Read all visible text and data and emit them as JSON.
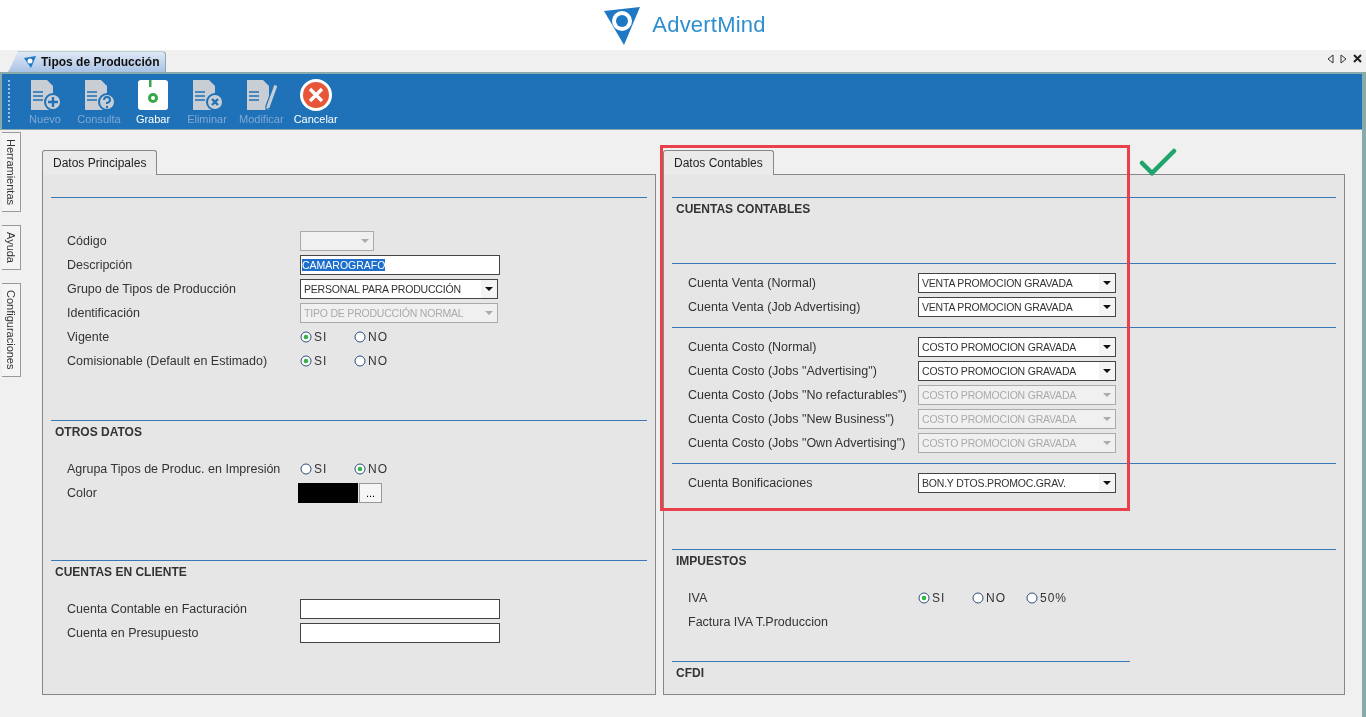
{
  "brand": {
    "name": "AdvertMind"
  },
  "document_tab": {
    "title": "Tipos de Producción",
    "selected": true
  },
  "toolbar": [
    {
      "label": "Nuevo",
      "kind": "new",
      "disabled": true
    },
    {
      "label": "Consulta",
      "kind": "query",
      "disabled": true
    },
    {
      "label": "Grabar",
      "kind": "save",
      "disabled": false
    },
    {
      "label": "Eliminar",
      "kind": "delete",
      "disabled": true
    },
    {
      "label": "Modificar",
      "kind": "edit",
      "disabled": true
    },
    {
      "label": "Cancelar",
      "kind": "cancel",
      "disabled": false
    }
  ],
  "side_tabs": [
    {
      "label": "Herramientas"
    },
    {
      "label": "Ayuda"
    },
    {
      "label": "Configuraciones"
    }
  ],
  "panels": [
    {
      "tab": "Datos Principales",
      "sections": [
        {
          "rows": [
            {
              "label": "Código",
              "kind": "select",
              "disabled": true
            },
            {
              "label": "Descripción",
              "kind": "text",
              "value": "CAMAROGRAFO",
              "selected": true
            },
            {
              "label": "Grupo de Tipos de Producción",
              "kind": "select",
              "value": "PERSONAL PARA PRODUCCIÓN",
              "disabled": false
            },
            {
              "label": "Identificación",
              "kind": "select",
              "value": "TIPO DE PRODUCCIÓN NORMAL",
              "disabled": true
            },
            {
              "label": "Vigente",
              "kind": "radio",
              "options": [
                {
                  "label": "SI",
                  "selected": true
                },
                {
                  "label": "NO",
                  "selected": false
                }
              ]
            },
            {
              "label": "Comisionable (Default en Estimado)",
              "kind": "radio",
              "options": [
                {
                  "label": "SI",
                  "selected": true
                },
                {
                  "label": "NO",
                  "selected": false
                }
              ]
            }
          ]
        },
        {
          "title": "OTROS DATOS",
          "rows": [
            {
              "label": "Agrupa Tipos de Produc. en Impresión",
              "kind": "radio",
              "options": [
                {
                  "label": "SI",
                  "selected": false
                },
                {
                  "label": "NO",
                  "selected": true
                }
              ]
            },
            {
              "label": "Color",
              "kind": "color",
              "color": "#000000",
              "button": "..."
            }
          ]
        },
        {
          "title": "CUENTAS EN CLIENTE",
          "rows": [
            {
              "label": "Cuenta Contable en Facturación",
              "kind": "text"
            },
            {
              "label": "Cuenta en Presupuesto",
              "kind": "text"
            }
          ]
        }
      ]
    },
    {
      "tab": "Datos Contables",
      "highlighted": true,
      "sections": [
        {
          "title": "CUENTAS CONTABLES"
        },
        {
          "rows": [
            {
              "label": "Cuenta Venta (Normal)",
              "kind": "select",
              "value": "VENTA PROMOCION GRAVADA",
              "disabled": false
            },
            {
              "label": "Cuenta Venta (Job Advertising)",
              "kind": "select",
              "value": "VENTA PROMOCION GRAVADA",
              "disabled": false
            }
          ]
        },
        {
          "rows": [
            {
              "label": "Cuenta Costo (Normal)",
              "kind": "select",
              "value": "COSTO PROMOCION GRAVADA",
              "disabled": false
            },
            {
              "label": "Cuenta Costo (Jobs \"Advertising\")",
              "kind": "select",
              "value": "COSTO PROMOCION GRAVADA",
              "disabled": false
            },
            {
              "label": "Cuenta Costo (Jobs \"No refacturables\")",
              "kind": "select",
              "value": "COSTO PROMOCION GRAVADA",
              "disabled": true
            },
            {
              "label": "Cuenta Costo (Jobs \"New Business\")",
              "kind": "select",
              "value": "COSTO PROMOCION GRAVADA",
              "disabled": true
            },
            {
              "label": "Cuenta Costo (Jobs \"Own Advertising\")",
              "kind": "select",
              "value": "COSTO PROMOCION GRAVADA",
              "disabled": true
            }
          ]
        },
        {
          "rows": [
            {
              "label": "Cuenta Bonificaciones",
              "kind": "select",
              "value": "BON.Y DTOS.PROMOC.GRAV.",
              "disabled": false
            }
          ]
        },
        {
          "title": "IMPUESTOS",
          "rows": [
            {
              "label": "IVA",
              "kind": "radio",
              "options": [
                {
                  "label": "SI",
                  "selected": true
                },
                {
                  "label": "NO",
                  "selected": false
                },
                {
                  "label": "50%",
                  "selected": false
                }
              ]
            },
            {
              "label": "Factura IVA T.Produccion",
              "kind": "label"
            }
          ]
        },
        {
          "title": "CFDI"
        }
      ]
    }
  ]
}
